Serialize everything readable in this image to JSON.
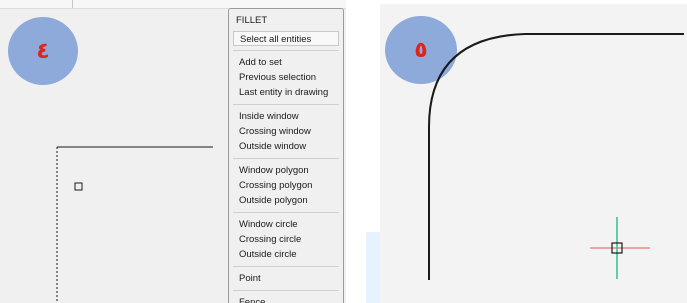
{
  "left_panel": {
    "badge_label": "٤",
    "menu": {
      "title": "FILLET",
      "groups": [
        [
          "Select all entities"
        ],
        [
          "Add to set",
          "Previous selection",
          "Last entity in drawing"
        ],
        [
          "Inside window",
          "Crossing window",
          "Outside window"
        ],
        [
          "Window polygon",
          "Crossing polygon",
          "Outside polygon"
        ],
        [
          "Window circle",
          "Crossing circle",
          "Outside circle"
        ],
        [
          "Point"
        ],
        [
          "Fence"
        ]
      ]
    }
  },
  "right_panel": {
    "badge_label": "٥",
    "crosshair_colors": {
      "horizontal": "#e05a5a",
      "vertical": "#2ec08a"
    }
  },
  "colors": {
    "badge_fill": "#8eaadb",
    "badge_text": "#e0241c",
    "menu_background": "#f0f0f0"
  }
}
